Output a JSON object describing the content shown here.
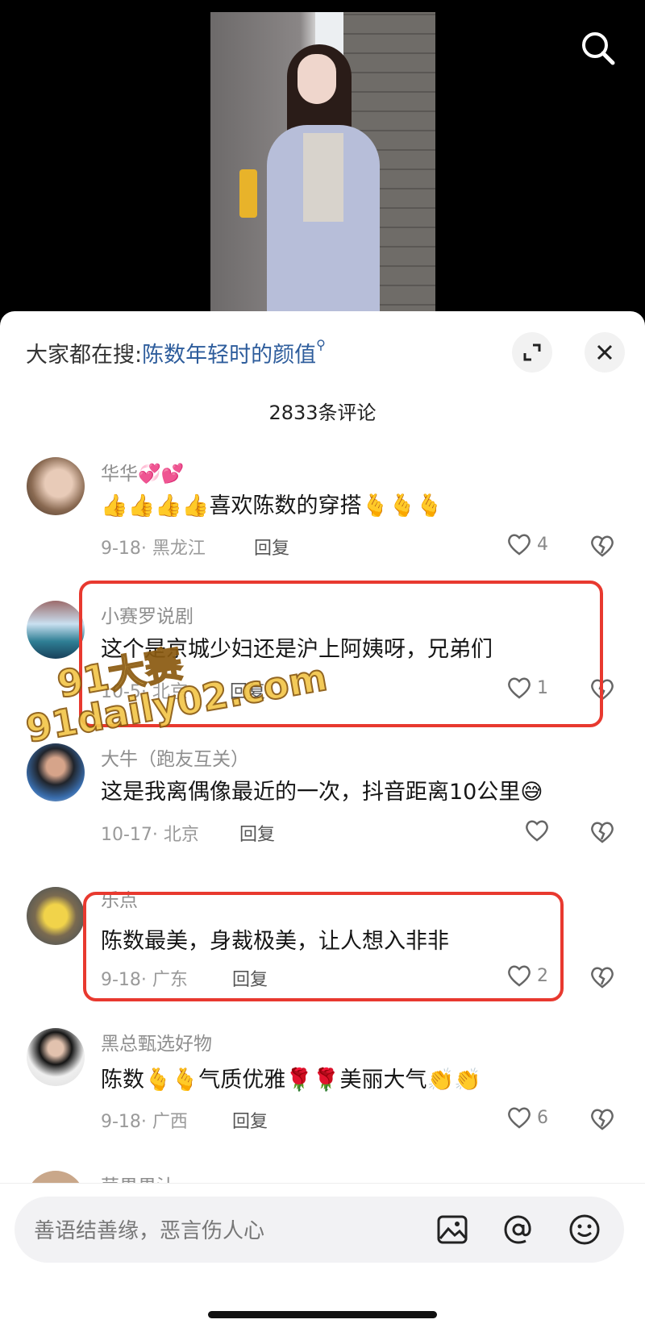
{
  "video": {
    "search_icon": "search-icon"
  },
  "sheet": {
    "hot_search_prefix": "大家都在搜:",
    "hot_search_link": "陈数年轻时的颜值",
    "comment_count": "2833条评论",
    "expand_icon": "expand-icon",
    "close_icon": "close-icon"
  },
  "comments": [
    {
      "user": "华华💞💕",
      "text": "👍👍👍👍喜欢陈数的穿搭🫰🫰🫰",
      "meta": "9-18· 黑龙江",
      "reply": "回复",
      "likes": "4"
    },
    {
      "user": "小赛罗说剧",
      "text": "这个是京城少妇还是沪上阿姨呀，兄弟们",
      "meta": "10-5· 北京",
      "reply": "回复",
      "likes": "1"
    },
    {
      "user": "大牛（跑友互关）",
      "text": "这是我离偶像最近的一次，抖音距离10公里😅",
      "meta": "10-17· 北京",
      "reply": "回复",
      "likes": ""
    },
    {
      "user": "乐点",
      "text": "陈数最美，身裁极美，让人想入非非",
      "meta": "9-18· 广东",
      "reply": "回复",
      "likes": "2"
    },
    {
      "user": "黑总甄选好物",
      "text": "陈数🫰🫰气质优雅🌹🌹美丽大气👏👏",
      "meta": "9-18· 广西",
      "reply": "回复",
      "likes": "6"
    },
    {
      "user": "苹果果汁"
    }
  ],
  "watermark": {
    "line1": "91大赛",
    "line2": "91daily02.com"
  },
  "input": {
    "placeholder": "善语结善缘，恶言伤人心",
    "image_icon": "image-icon",
    "at_icon": "at-icon",
    "emoji_icon": "emoji-icon"
  }
}
